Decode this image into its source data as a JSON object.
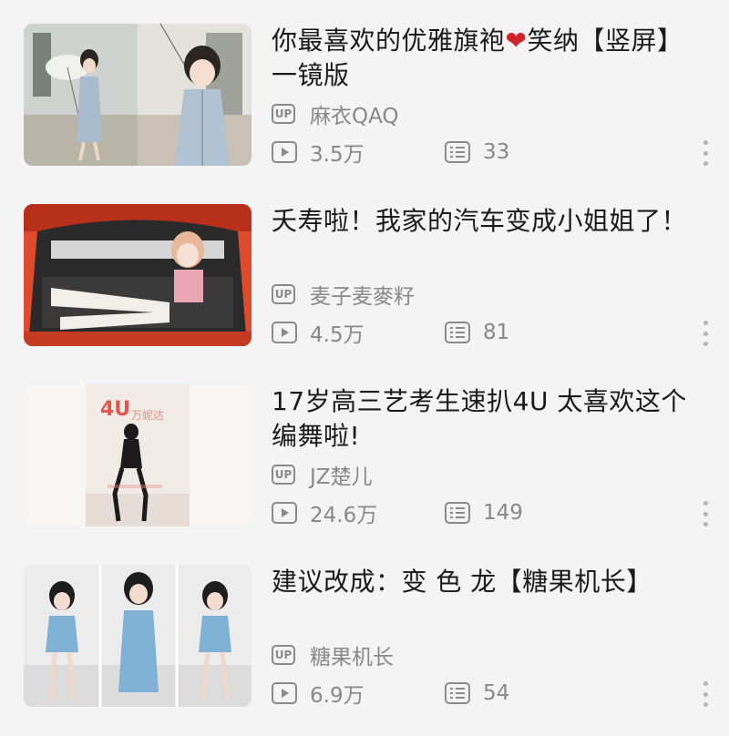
{
  "videos": [
    {
      "title_pre": "你最喜欢的优雅旗袍",
      "title_emoji": "❤️",
      "title_post": "笑纳【竖屏】一镜版",
      "uploader": "麻衣QAQ",
      "views": "3.5万",
      "danmaku": "33",
      "thumb": "cheongsam-umbrella"
    },
    {
      "title_pre": "夭寿啦！我家的汽车变成小姐姐了！",
      "title_emoji": "",
      "title_post": "",
      "uploader": "麦子麦麥籽",
      "views": "4.5万",
      "danmaku": "81",
      "thumb": "car-trunk"
    },
    {
      "title_pre": "17岁高三艺考生速扒4U  太喜欢这个编舞啦!",
      "title_emoji": "",
      "title_post": "",
      "uploader": "JZ楚儿",
      "views": "24.6万",
      "danmaku": "149",
      "thumb": "dance-4u",
      "thumb_text": "4U",
      "thumb_text2": "万妮达"
    },
    {
      "title_pre": "建议改成：变  色  龙【糖果机长】",
      "title_emoji": "",
      "title_post": "",
      "uploader": "糖果机长",
      "views": "6.9万",
      "danmaku": "54",
      "thumb": "blue-dress-triptych"
    }
  ],
  "labels": {
    "up_badge": "UP"
  },
  "colors": {
    "background": "#f4f4f4",
    "title": "#1a1a1a",
    "meta": "#888888",
    "heart": "#d2232a"
  },
  "icons": [
    "up-badge-icon",
    "play-icon",
    "danmaku-icon",
    "more-vertical-icon"
  ]
}
